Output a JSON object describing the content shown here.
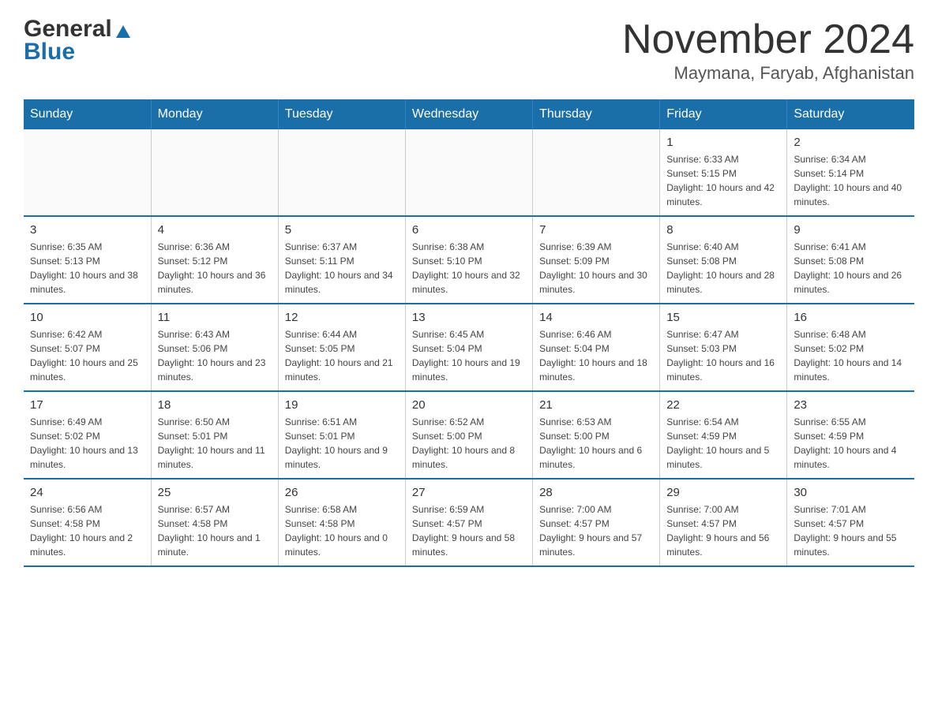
{
  "header": {
    "logo_general": "General",
    "logo_blue": "Blue",
    "month_title": "November 2024",
    "location": "Maymana, Faryab, Afghanistan"
  },
  "days_of_week": [
    "Sunday",
    "Monday",
    "Tuesday",
    "Wednesday",
    "Thursday",
    "Friday",
    "Saturday"
  ],
  "weeks": [
    [
      {
        "day": "",
        "sunrise": "",
        "sunset": "",
        "daylight": ""
      },
      {
        "day": "",
        "sunrise": "",
        "sunset": "",
        "daylight": ""
      },
      {
        "day": "",
        "sunrise": "",
        "sunset": "",
        "daylight": ""
      },
      {
        "day": "",
        "sunrise": "",
        "sunset": "",
        "daylight": ""
      },
      {
        "day": "",
        "sunrise": "",
        "sunset": "",
        "daylight": ""
      },
      {
        "day": "1",
        "sunrise": "Sunrise: 6:33 AM",
        "sunset": "Sunset: 5:15 PM",
        "daylight": "Daylight: 10 hours and 42 minutes."
      },
      {
        "day": "2",
        "sunrise": "Sunrise: 6:34 AM",
        "sunset": "Sunset: 5:14 PM",
        "daylight": "Daylight: 10 hours and 40 minutes."
      }
    ],
    [
      {
        "day": "3",
        "sunrise": "Sunrise: 6:35 AM",
        "sunset": "Sunset: 5:13 PM",
        "daylight": "Daylight: 10 hours and 38 minutes."
      },
      {
        "day": "4",
        "sunrise": "Sunrise: 6:36 AM",
        "sunset": "Sunset: 5:12 PM",
        "daylight": "Daylight: 10 hours and 36 minutes."
      },
      {
        "day": "5",
        "sunrise": "Sunrise: 6:37 AM",
        "sunset": "Sunset: 5:11 PM",
        "daylight": "Daylight: 10 hours and 34 minutes."
      },
      {
        "day": "6",
        "sunrise": "Sunrise: 6:38 AM",
        "sunset": "Sunset: 5:10 PM",
        "daylight": "Daylight: 10 hours and 32 minutes."
      },
      {
        "day": "7",
        "sunrise": "Sunrise: 6:39 AM",
        "sunset": "Sunset: 5:09 PM",
        "daylight": "Daylight: 10 hours and 30 minutes."
      },
      {
        "day": "8",
        "sunrise": "Sunrise: 6:40 AM",
        "sunset": "Sunset: 5:08 PM",
        "daylight": "Daylight: 10 hours and 28 minutes."
      },
      {
        "day": "9",
        "sunrise": "Sunrise: 6:41 AM",
        "sunset": "Sunset: 5:08 PM",
        "daylight": "Daylight: 10 hours and 26 minutes."
      }
    ],
    [
      {
        "day": "10",
        "sunrise": "Sunrise: 6:42 AM",
        "sunset": "Sunset: 5:07 PM",
        "daylight": "Daylight: 10 hours and 25 minutes."
      },
      {
        "day": "11",
        "sunrise": "Sunrise: 6:43 AM",
        "sunset": "Sunset: 5:06 PM",
        "daylight": "Daylight: 10 hours and 23 minutes."
      },
      {
        "day": "12",
        "sunrise": "Sunrise: 6:44 AM",
        "sunset": "Sunset: 5:05 PM",
        "daylight": "Daylight: 10 hours and 21 minutes."
      },
      {
        "day": "13",
        "sunrise": "Sunrise: 6:45 AM",
        "sunset": "Sunset: 5:04 PM",
        "daylight": "Daylight: 10 hours and 19 minutes."
      },
      {
        "day": "14",
        "sunrise": "Sunrise: 6:46 AM",
        "sunset": "Sunset: 5:04 PM",
        "daylight": "Daylight: 10 hours and 18 minutes."
      },
      {
        "day": "15",
        "sunrise": "Sunrise: 6:47 AM",
        "sunset": "Sunset: 5:03 PM",
        "daylight": "Daylight: 10 hours and 16 minutes."
      },
      {
        "day": "16",
        "sunrise": "Sunrise: 6:48 AM",
        "sunset": "Sunset: 5:02 PM",
        "daylight": "Daylight: 10 hours and 14 minutes."
      }
    ],
    [
      {
        "day": "17",
        "sunrise": "Sunrise: 6:49 AM",
        "sunset": "Sunset: 5:02 PM",
        "daylight": "Daylight: 10 hours and 13 minutes."
      },
      {
        "day": "18",
        "sunrise": "Sunrise: 6:50 AM",
        "sunset": "Sunset: 5:01 PM",
        "daylight": "Daylight: 10 hours and 11 minutes."
      },
      {
        "day": "19",
        "sunrise": "Sunrise: 6:51 AM",
        "sunset": "Sunset: 5:01 PM",
        "daylight": "Daylight: 10 hours and 9 minutes."
      },
      {
        "day": "20",
        "sunrise": "Sunrise: 6:52 AM",
        "sunset": "Sunset: 5:00 PM",
        "daylight": "Daylight: 10 hours and 8 minutes."
      },
      {
        "day": "21",
        "sunrise": "Sunrise: 6:53 AM",
        "sunset": "Sunset: 5:00 PM",
        "daylight": "Daylight: 10 hours and 6 minutes."
      },
      {
        "day": "22",
        "sunrise": "Sunrise: 6:54 AM",
        "sunset": "Sunset: 4:59 PM",
        "daylight": "Daylight: 10 hours and 5 minutes."
      },
      {
        "day": "23",
        "sunrise": "Sunrise: 6:55 AM",
        "sunset": "Sunset: 4:59 PM",
        "daylight": "Daylight: 10 hours and 4 minutes."
      }
    ],
    [
      {
        "day": "24",
        "sunrise": "Sunrise: 6:56 AM",
        "sunset": "Sunset: 4:58 PM",
        "daylight": "Daylight: 10 hours and 2 minutes."
      },
      {
        "day": "25",
        "sunrise": "Sunrise: 6:57 AM",
        "sunset": "Sunset: 4:58 PM",
        "daylight": "Daylight: 10 hours and 1 minute."
      },
      {
        "day": "26",
        "sunrise": "Sunrise: 6:58 AM",
        "sunset": "Sunset: 4:58 PM",
        "daylight": "Daylight: 10 hours and 0 minutes."
      },
      {
        "day": "27",
        "sunrise": "Sunrise: 6:59 AM",
        "sunset": "Sunset: 4:57 PM",
        "daylight": "Daylight: 9 hours and 58 minutes."
      },
      {
        "day": "28",
        "sunrise": "Sunrise: 7:00 AM",
        "sunset": "Sunset: 4:57 PM",
        "daylight": "Daylight: 9 hours and 57 minutes."
      },
      {
        "day": "29",
        "sunrise": "Sunrise: 7:00 AM",
        "sunset": "Sunset: 4:57 PM",
        "daylight": "Daylight: 9 hours and 56 minutes."
      },
      {
        "day": "30",
        "sunrise": "Sunrise: 7:01 AM",
        "sunset": "Sunset: 4:57 PM",
        "daylight": "Daylight: 9 hours and 55 minutes."
      }
    ]
  ]
}
